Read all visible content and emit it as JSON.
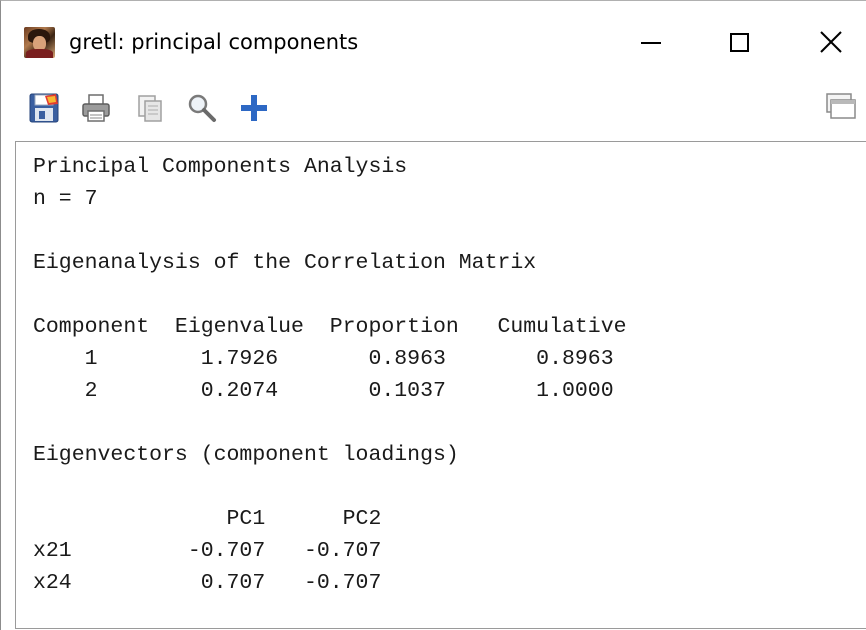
{
  "window": {
    "title": "gretl: principal components",
    "app_icon": "gretl-portrait-icon",
    "controls": [
      "minimize-icon",
      "maximize-icon",
      "close-icon"
    ]
  },
  "toolbar": {
    "items": [
      "save-icon",
      "print-icon",
      "copy-icon",
      "find-icon",
      "add-icon"
    ],
    "right_items": [
      "window-list-icon"
    ]
  },
  "output": {
    "lines": [
      "Principal Components Analysis",
      "n = 7",
      "",
      "Eigenanalysis of the Correlation Matrix",
      "",
      "Component  Eigenvalue  Proportion   Cumulative",
      "    1        1.7926       0.8963       0.8963",
      "    2        0.2074       0.1037       1.0000",
      "",
      "Eigenvectors (component loadings)",
      "",
      "               PC1      PC2",
      "x21         -0.707   -0.707",
      "x24          0.707   -0.707"
    ]
  }
}
